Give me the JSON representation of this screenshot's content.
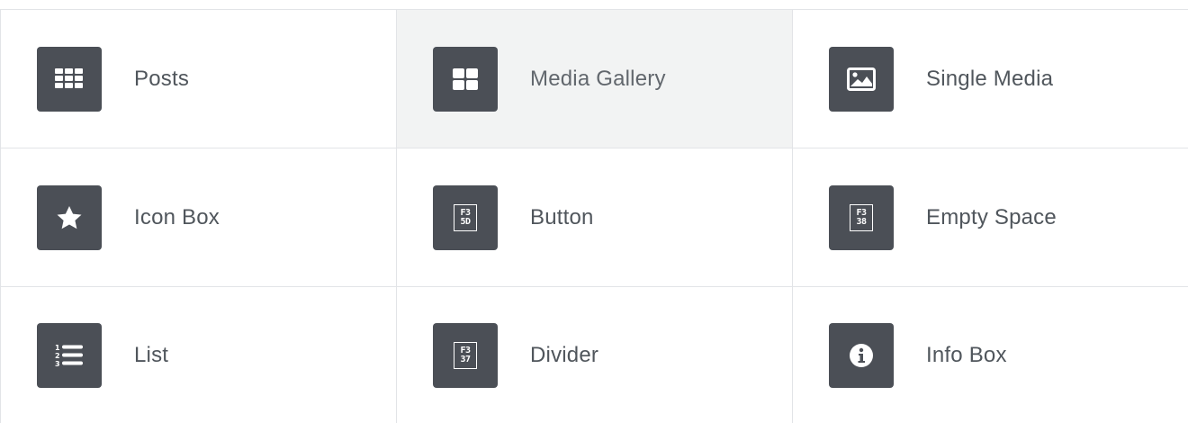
{
  "blocks": [
    {
      "label": "Posts",
      "icon": "grid-icon"
    },
    {
      "label": "Media Gallery",
      "icon": "gallery-icon",
      "hovered": true
    },
    {
      "label": "Single Media",
      "icon": "image-icon"
    },
    {
      "label": "Icon Box",
      "icon": "star-icon"
    },
    {
      "label": "Button",
      "icon": "missing-glyph-icon",
      "glyph": [
        "F3",
        "5D"
      ]
    },
    {
      "label": "Empty Space",
      "icon": "missing-glyph-icon",
      "glyph": [
        "F3",
        "38"
      ]
    },
    {
      "label": "List",
      "icon": "ordered-list-icon"
    },
    {
      "label": "Divider",
      "icon": "missing-glyph-icon",
      "glyph": [
        "F3",
        "37"
      ]
    },
    {
      "label": "Info Box",
      "icon": "info-icon"
    }
  ],
  "colors": {
    "tile_background": "#4b4f56",
    "label_text": "#50565c",
    "hover_background": "#f2f3f3",
    "border": "#e2e4e7"
  }
}
